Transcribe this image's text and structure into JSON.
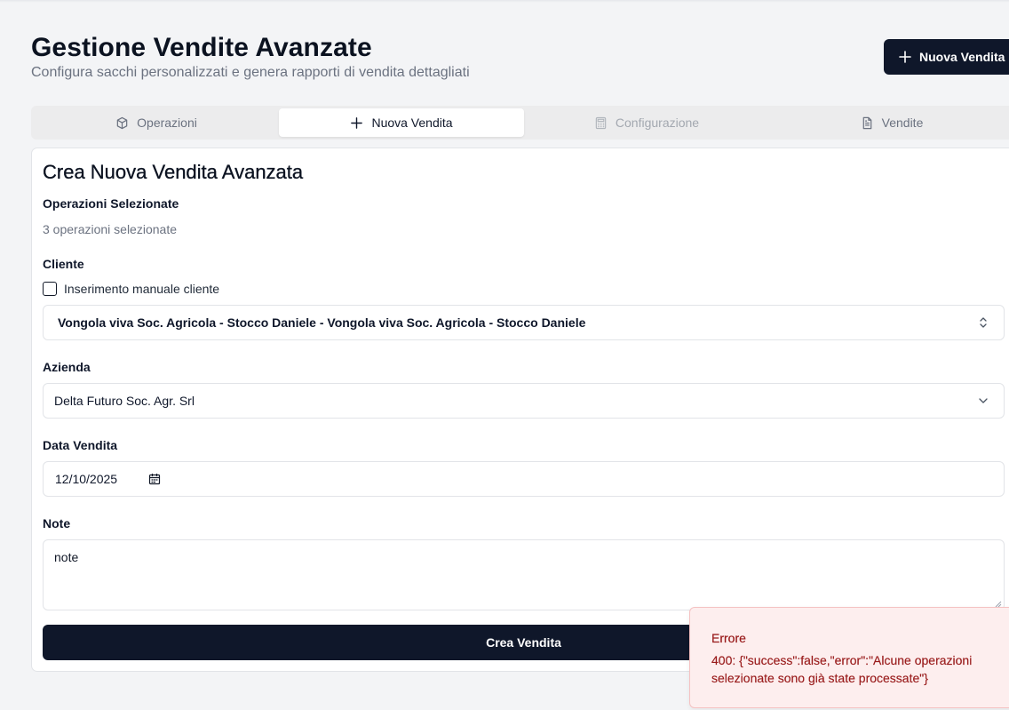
{
  "header": {
    "title": "Gestione Vendite Avanzate",
    "subtitle": "Configura sacchi personalizzati e genera rapporti di vendita dettagliati",
    "new_sale_button": {
      "label": "Nuova Vendita",
      "icon": "plus-icon"
    }
  },
  "tabs": [
    {
      "label": "Operazioni",
      "icon": "box-icon",
      "state": "default"
    },
    {
      "label": "Nuova Vendita",
      "icon": "plus-icon",
      "state": "active"
    },
    {
      "label": "Configurazione",
      "icon": "calculator-icon",
      "state": "disabled"
    },
    {
      "label": "Vendite",
      "icon": "document-icon",
      "state": "default"
    }
  ],
  "form": {
    "title": "Crea Nuova Vendita Avanzata",
    "operations_label": "Operazioni Selezionate",
    "operations_count_text": "3 operazioni selezionate",
    "client_label": "Cliente",
    "manual_client_label": "Inserimento manuale cliente",
    "manual_client_checked": false,
    "client_value": "Vongola viva Soc. Agricola - Stocco Daniele - Vongola viva Soc. Agricola - Stocco Daniele",
    "company_label": "Azienda",
    "company_value": "Delta Futuro Soc. Agr. Srl",
    "date_label": "Data Vendita",
    "date_value": "12/10/2025",
    "notes_label": "Note",
    "notes_value": "note",
    "submit_label": "Crea Vendita"
  },
  "toast": {
    "title": "Errore",
    "message": "400: {\"success\":false,\"error\":\"Alcune operazioni selezionate sono già state processate\"}"
  },
  "colors": {
    "primary": "#0f172a",
    "background": "#f3f4f6",
    "error_bg": "#fdeeee",
    "error_text": "#991b1b"
  }
}
